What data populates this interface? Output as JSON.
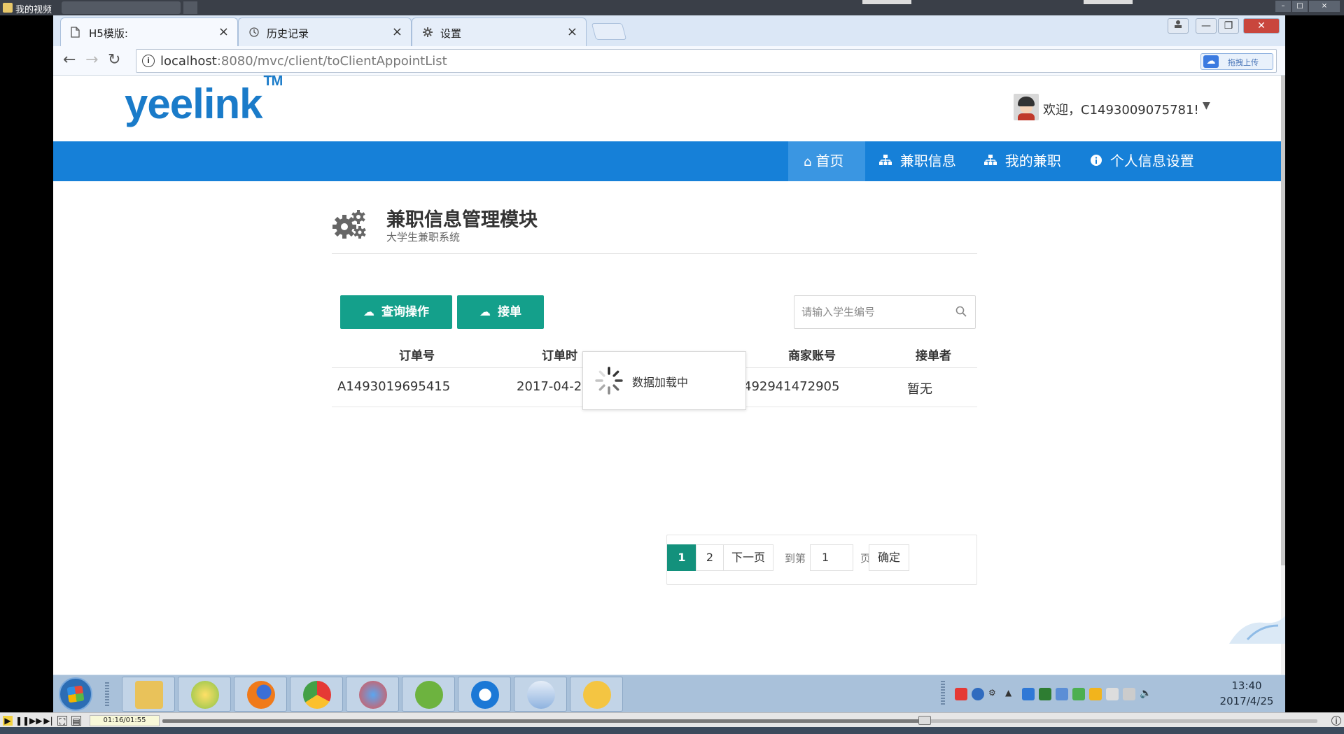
{
  "player": {
    "title": "我的视频",
    "time": "01:16/01:55",
    "progress_fraction": 0.66
  },
  "browser": {
    "tabs": [
      {
        "label": "H5模版:",
        "icon": "page-icon",
        "active": true
      },
      {
        "label": "历史记录",
        "icon": "history-icon",
        "active": false
      },
      {
        "label": "设置",
        "icon": "gear-icon",
        "active": false
      }
    ],
    "url_host": "localhost",
    "url_rest": ":8080/mvc/client/toClientAppointList",
    "ext_label": "拖拽上传",
    "close_glyph": "×",
    "back_glyph": "←",
    "forward_glyph": "→",
    "reload_glyph": "↻"
  },
  "site": {
    "logo": "yeelink",
    "logo_tm": "TM",
    "welcome": "欢迎，C1493009075781!",
    "nav": [
      {
        "label": "首页",
        "icon": "home-icon",
        "active": true
      },
      {
        "label": "兼职信息",
        "icon": "sitemap-icon",
        "active": false
      },
      {
        "label": "我的兼职",
        "icon": "sitemap-icon",
        "active": false
      },
      {
        "label": "个人信息设置",
        "icon": "info-icon",
        "active": false
      }
    ]
  },
  "module": {
    "title": "兼职信息管理模块",
    "subtitle": "大学生兼职系统",
    "query_button": "查询操作",
    "accept_button": "接单",
    "search_placeholder": "请输入学生编号"
  },
  "table": {
    "headers": [
      "订单号",
      "订单时间",
      "商家账号",
      "接单者"
    ],
    "header_visible": [
      "订单号",
      "订单时",
      "",
      "商家账号",
      "接单者"
    ],
    "rows": [
      {
        "order_no": "A1493019695415",
        "time": "2017-04-24",
        "merchant": "492941472905",
        "taker": "暂无"
      }
    ]
  },
  "loading": {
    "text": "数据加载中"
  },
  "pagination": {
    "pages": [
      "1",
      "2"
    ],
    "current": "1",
    "next": "下一页",
    "goto_label": "到第",
    "goto_value": "1",
    "page_suffix": "页",
    "confirm": "确定"
  },
  "taskbar": {
    "time": "13:40",
    "date": "2017/4/25"
  },
  "colors": {
    "nav_blue": "#1680d8",
    "nav_active": "#3a96e2",
    "logo_blue": "#1a7bc9",
    "green": "#14a08b",
    "pager_green": "#13917c"
  }
}
